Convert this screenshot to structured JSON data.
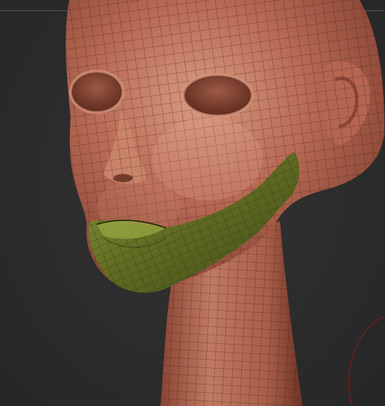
{
  "viewport": {
    "background_color": "#2b2b2b",
    "model": {
      "subject": "stylized-head-mesh",
      "skin_color": "#b86a55",
      "skin_highlight": "#d79479",
      "skin_shadow": "#7a3a2a",
      "wire_color": "#3b1d16",
      "mask_color": "#5f6a22",
      "mask_highlight": "#8a9a3a"
    },
    "gizmo": {
      "icon": "rotation-arc-icon",
      "color": "#7a1a1a"
    }
  }
}
